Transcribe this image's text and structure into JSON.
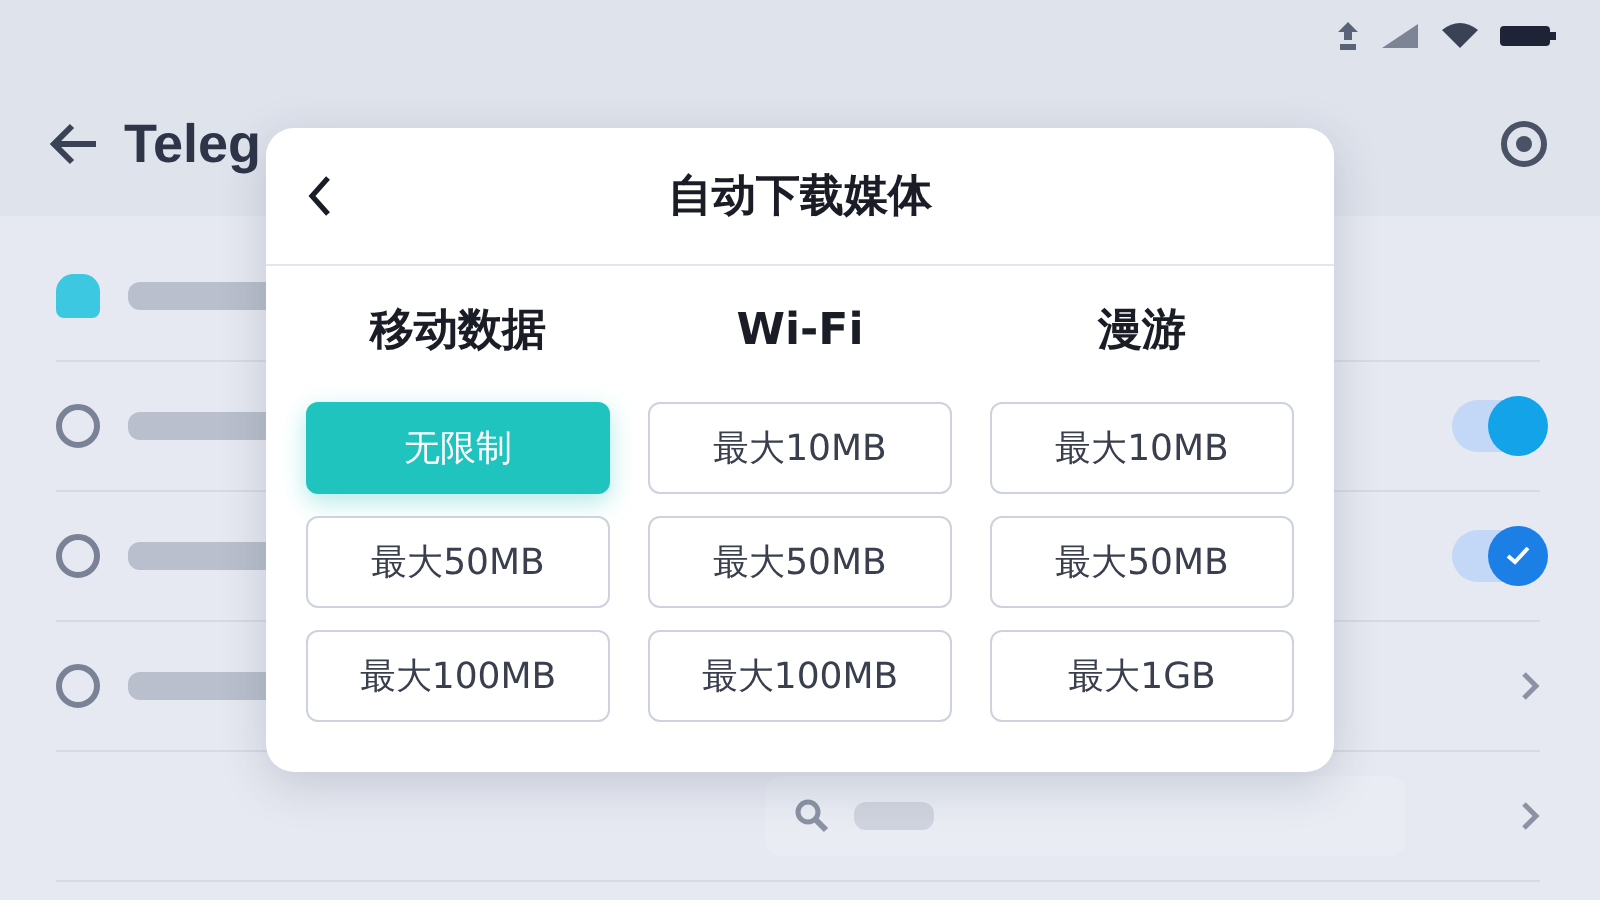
{
  "app_bar": {
    "title": "Teleg"
  },
  "settings_list": [
    {
      "kind": "plain"
    },
    {
      "kind": "toggle",
      "on": true
    },
    {
      "kind": "check",
      "checked": true
    },
    {
      "kind": "arrow"
    },
    {
      "kind": "search"
    }
  ],
  "dialog": {
    "title": "自动下载媒体",
    "columns": [
      {
        "heading": "移动数据",
        "options": [
          {
            "label": "无限制",
            "selected": true
          },
          {
            "label": "最大50MB",
            "selected": false
          },
          {
            "label": "最大100MB",
            "selected": false
          }
        ]
      },
      {
        "heading": "Wi-Fi",
        "options": [
          {
            "label": "最大10MB",
            "selected": false
          },
          {
            "label": "最大50MB",
            "selected": false
          },
          {
            "label": "最大100MB",
            "selected": false
          }
        ]
      },
      {
        "heading": "漫游",
        "options": [
          {
            "label": "最大10MB",
            "selected": false
          },
          {
            "label": "最大50MB",
            "selected": false
          },
          {
            "label": "最大1GB",
            "selected": false
          }
        ]
      }
    ]
  }
}
